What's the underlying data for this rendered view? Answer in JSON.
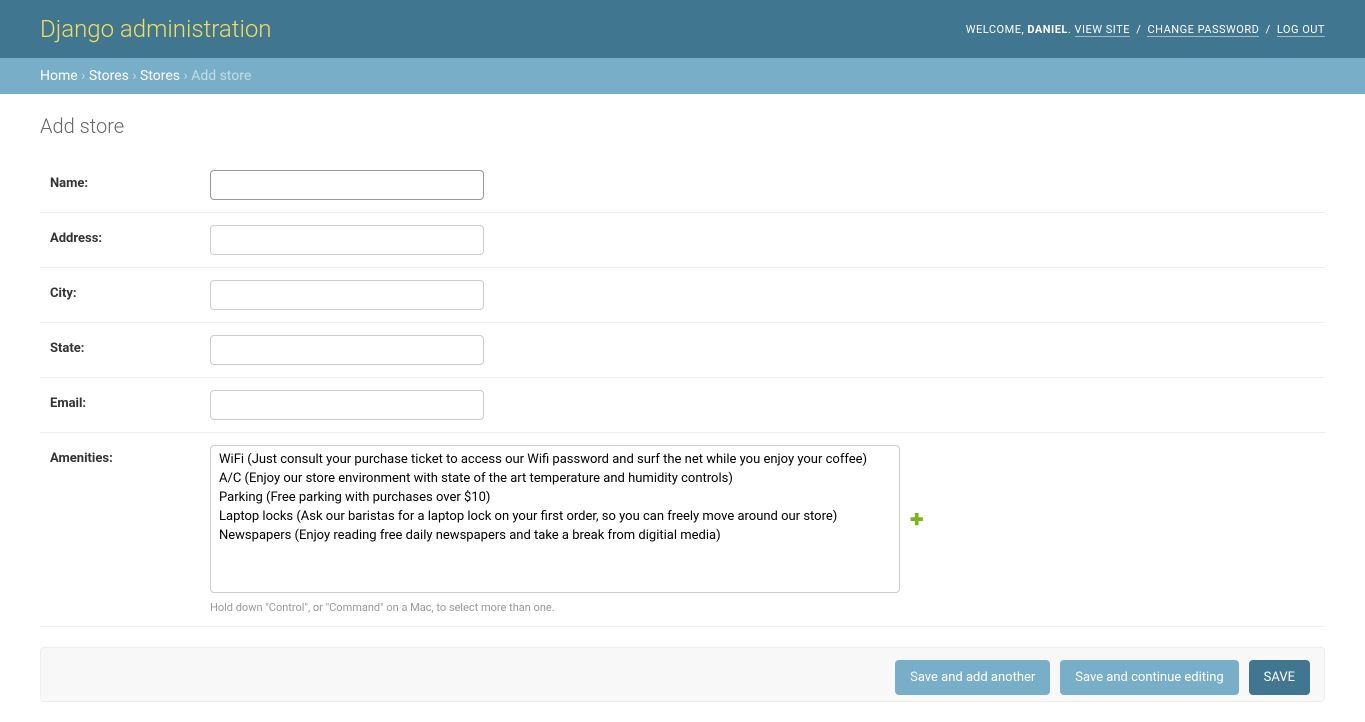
{
  "header": {
    "branding": "Django administration",
    "welcome": "WELCOME, ",
    "username": "DANIEL",
    "view_site": "VIEW SITE",
    "change_password": "CHANGE PASSWORD",
    "logout": "LOG OUT"
  },
  "breadcrumbs": {
    "home": "Home",
    "app": "Stores",
    "model": "Stores",
    "current": "Add store",
    "sep": " › "
  },
  "page": {
    "title": "Add store"
  },
  "form": {
    "name_label": "Name:",
    "name_value": "",
    "address_label": "Address:",
    "address_value": "",
    "city_label": "City:",
    "city_value": "",
    "state_label": "State:",
    "state_value": "",
    "email_label": "Email:",
    "email_value": "",
    "amenities_label": "Amenities:",
    "amenities_options": [
      "WiFi (Just consult your purchase ticket to access our Wifi password and surf the net while you enjoy your coffee)",
      "A/C (Enjoy our store environment with state of the art temperature and humidity controls)",
      "Parking (Free parking with purchases over $10)",
      "Laptop locks (Ask our baristas for a laptop lock on your first order, so you can freely move around our store)",
      "Newspapers (Enjoy reading free daily newspapers and take a break from digitial media)"
    ],
    "amenities_help": "Hold down \"Control\", or \"Command\" on a Mac, to select more than one."
  },
  "buttons": {
    "save_add_another": "Save and add another",
    "save_continue": "Save and continue editing",
    "save": "SAVE"
  }
}
